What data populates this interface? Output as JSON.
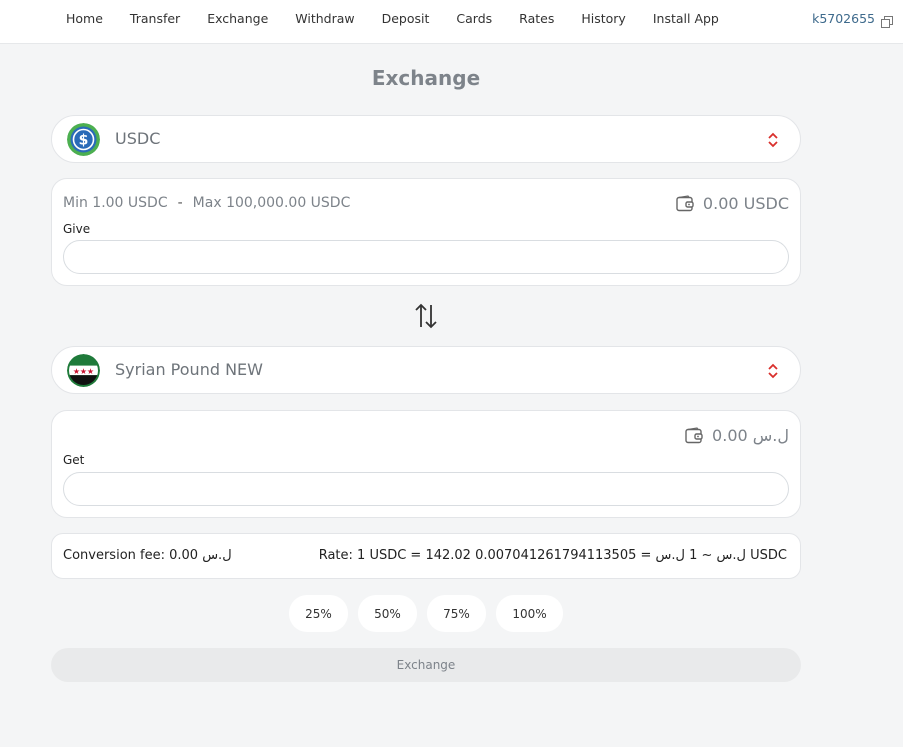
{
  "nav": {
    "items": [
      {
        "label": "Home"
      },
      {
        "label": "Transfer"
      },
      {
        "label": "Exchange"
      },
      {
        "label": "Withdraw"
      },
      {
        "label": "Deposit"
      },
      {
        "label": "Cards"
      },
      {
        "label": "Rates"
      },
      {
        "label": "History"
      },
      {
        "label": "Install App"
      }
    ],
    "account_id": "k5702655",
    "copy_icon": "copy-icon"
  },
  "page": {
    "title": "Exchange"
  },
  "from": {
    "currency_label": "USDC",
    "icon": "usdc-icon",
    "min_label": "Min 1.00 USDC",
    "separator": "-",
    "max_label": "Max 100,000.00 USDC",
    "balance": "0.00 USDC",
    "field_label": "Give",
    "value": "",
    "placeholder": ""
  },
  "to": {
    "currency_label": "Syrian Pound NEW",
    "icon": "syria-flag-icon",
    "balance": "ل.س 0.00",
    "field_label": "Get",
    "value": "",
    "placeholder": ""
  },
  "info": {
    "fee": "Conversion fee: 0.00 ل.س",
    "rate": "Rate: 1 USDC = 142.02 ل.س ~ 1 ل.س = 0.007041261794113505 USDC"
  },
  "percent_buttons": [
    {
      "label": "25%"
    },
    {
      "label": "50%"
    },
    {
      "label": "75%"
    },
    {
      "label": "100%"
    }
  ],
  "submit_label": "Exchange",
  "colors": {
    "accent_red": "#d9302c",
    "usdc_blue": "#2a6bb8",
    "usdc_green": "#4caf50",
    "flag_green": "#1f7a3a",
    "account_blue": "#3e6a8c"
  }
}
